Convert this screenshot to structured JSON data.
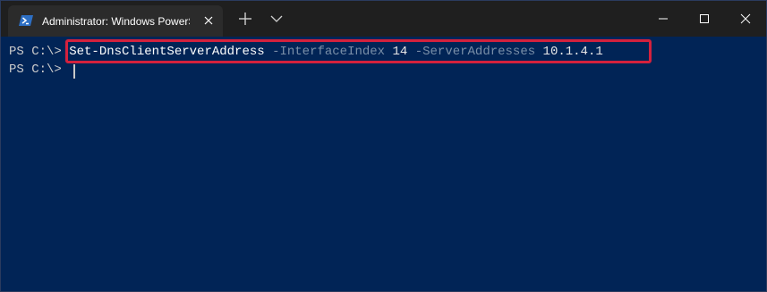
{
  "window": {
    "tab_title": "Administrator: Windows PowerS",
    "tab_icon": "powershell-icon",
    "tab_close_icon": "close-icon",
    "new_tab_icon": "plus-icon",
    "dropdown_icon": "chevron-down-icon",
    "minimize_icon": "minimize-icon",
    "maximize_icon": "maximize-icon",
    "close_icon": "close-icon"
  },
  "terminal": {
    "background": "#012456",
    "highlight_color": "#d4213d",
    "lines": [
      {
        "prompt": "PS C:\\>",
        "cmdlet": "Set-DnsClientServerAddress",
        "param1": "-InterfaceIndex",
        "value1": "14",
        "param2": "-ServerAddresses",
        "value2": "10.1.4.1"
      },
      {
        "prompt": "PS C:\\>"
      }
    ]
  }
}
